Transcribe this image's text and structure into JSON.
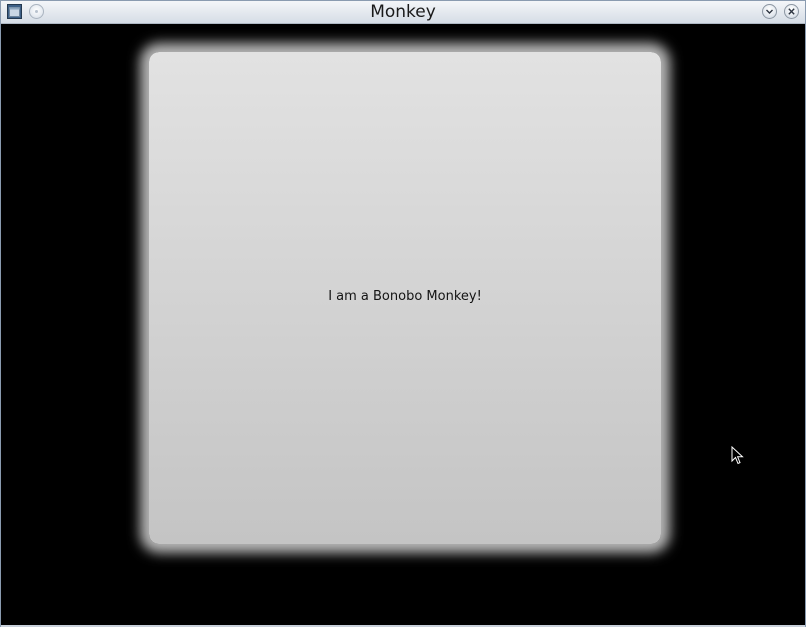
{
  "window": {
    "title": "Monkey"
  },
  "titlebar": {
    "icons": {
      "app": "window-app-icon",
      "menu": "window-menu-icon",
      "minimize": "chevron-down-icon",
      "close": "close-icon"
    }
  },
  "panel": {
    "label": "I am a Bonobo Monkey!"
  },
  "colors": {
    "background": "#000000",
    "panel": "#d3d3d3",
    "titlebar": "#e3e8ee"
  }
}
